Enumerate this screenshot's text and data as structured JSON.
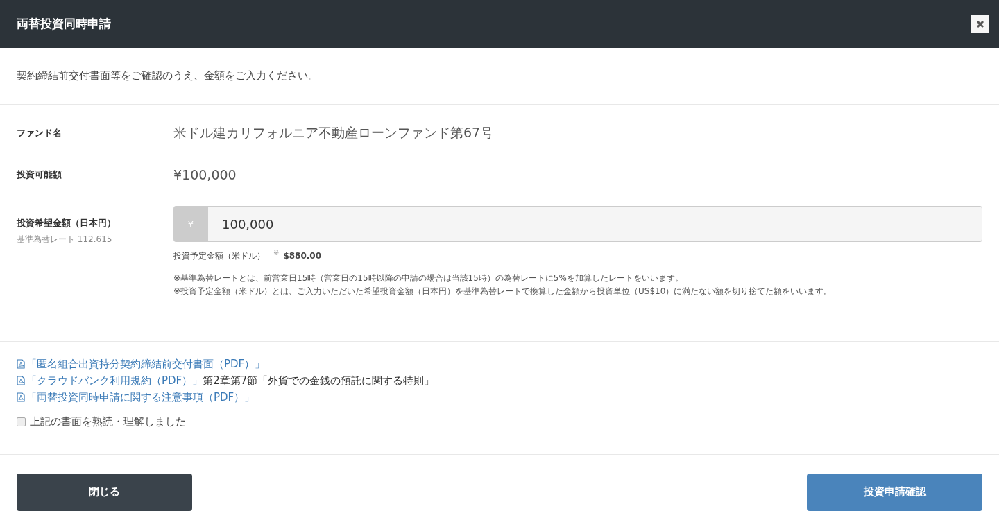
{
  "dialog": {
    "title": "両替投資同時申請",
    "intro": "契約締結前交付書面等をご確認のうえ、金額をご入力ください。"
  },
  "fund": {
    "label": "ファンド名",
    "value": "米ドル建カリフォルニア不動産ローンファンド第67号"
  },
  "available": {
    "label": "投資可能額",
    "value": "¥100,000"
  },
  "amount": {
    "label": "投資希望金額（日本円）",
    "rate": "基準為替レート 112.615",
    "prefix": "¥",
    "value": "100,000",
    "usd_label": "投資予定金額（米ドル）",
    "usd_mark": "※",
    "usd_value": "$880.00",
    "notes": [
      "※基準為替レートとは、前営業日15時（営業日の15時以降の申請の場合は当該15時）の為替レートに5%を加算したレートをいいます。",
      "※投資予定金額（米ドル）とは、ご入力いただいた希望投資金額（日本円）を基準為替レートで換算した金額から投資単位（US$10）に満たない額を切り捨てた額をいいます。"
    ]
  },
  "documents": [
    {
      "link": "「匿名組合出資持分契約締結前交付書面（PDF）」"
    },
    {
      "link": "「クラウドバンク利用規約（PDF）」",
      "suffix": "第2章第7節「外貨での金銭の預託に関する特則」"
    },
    {
      "link": "「両替投資同時申請に関する注意事項（PDF）」"
    }
  ],
  "agreement": {
    "label": "上記の書面を熟読・理解しました",
    "checked": false
  },
  "buttons": [
    {
      "kind": "close",
      "label": "閉じる"
    },
    {
      "kind": "confirm",
      "label": "投資申請確認"
    }
  ]
}
